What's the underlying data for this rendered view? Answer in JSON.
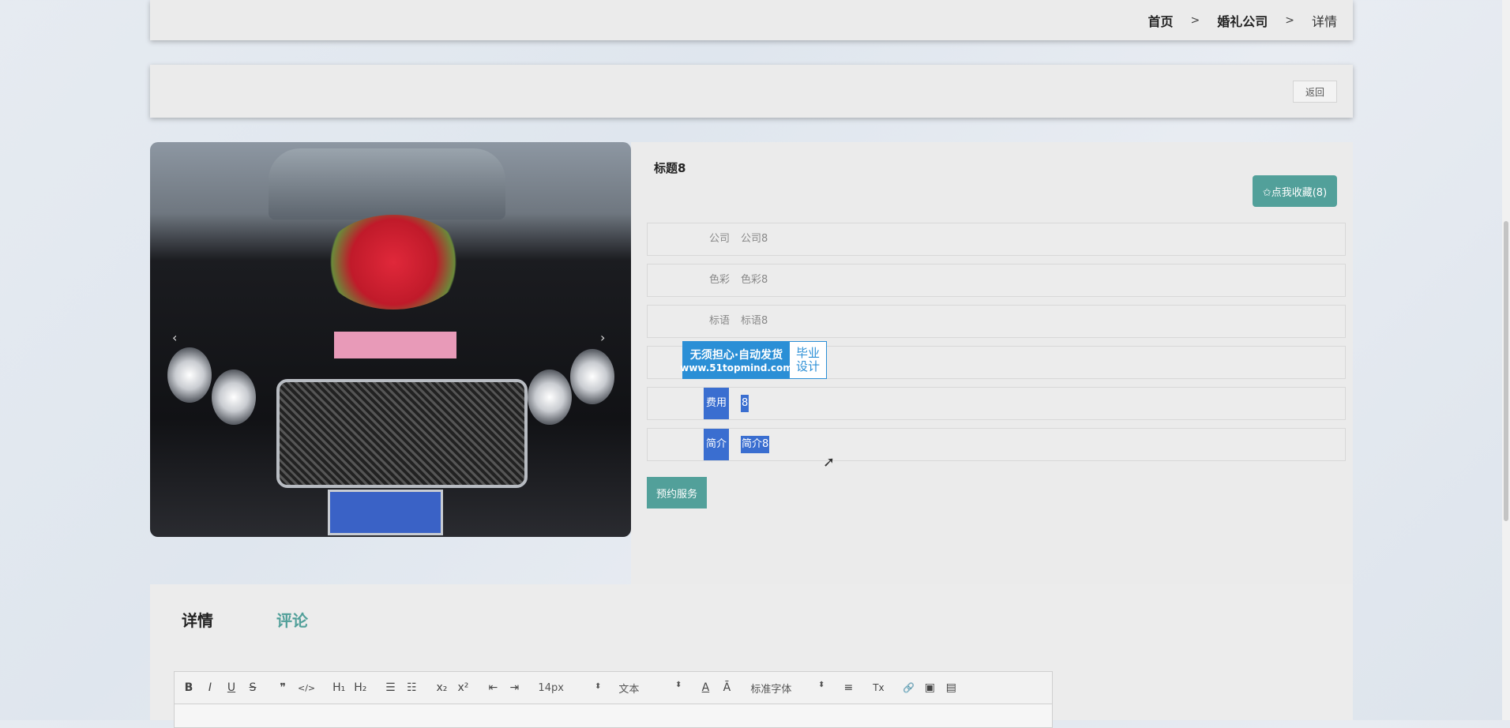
{
  "breadcrumb": {
    "home": "首页",
    "sep1": ">",
    "section": "婚礼公司",
    "sep2": ">",
    "current": "详情"
  },
  "actions": {
    "back_label": "返回"
  },
  "product": {
    "title": "标题8",
    "favorite_label": "✩点我收藏(8)",
    "fields": [
      {
        "label": "公司",
        "value": "公司8"
      },
      {
        "label": "色彩",
        "value": "色彩8"
      },
      {
        "label": "标语",
        "value": "标语8"
      },
      {
        "label": "",
        "value": ""
      },
      {
        "label": "费用",
        "value": "8"
      },
      {
        "label": "简介",
        "value": "简介8"
      }
    ],
    "book_label": "预约服务",
    "carousel": {
      "prev": "‹",
      "next": "›"
    }
  },
  "watermark": {
    "line1": "无须担心·自动发货",
    "line2": "www.51topmind.com",
    "side1": "毕业",
    "side2": "设计"
  },
  "tabs": [
    {
      "label": "详情"
    },
    {
      "label": "评论"
    }
  ],
  "editor": {
    "toolbar": {
      "bold": "B",
      "italic": "I",
      "underline": "U",
      "strike": "S",
      "quote": "❞",
      "code": "</>",
      "h1": "H₁",
      "h2": "H₂",
      "ordered_list": "☰",
      "bullet_list": "☷",
      "subscript": "x₂",
      "superscript": "x²",
      "outdent": "⇤",
      "indent": "⇥",
      "size": "14px",
      "block": "文本",
      "font": "标准字体",
      "color": "A",
      "background": "Ā",
      "align": "≡",
      "clean": "Tx",
      "link": "🔗",
      "image": "▣",
      "video": "▤"
    }
  },
  "colors": {
    "accent": "#52a09a",
    "selection": "#3a6ed0"
  }
}
